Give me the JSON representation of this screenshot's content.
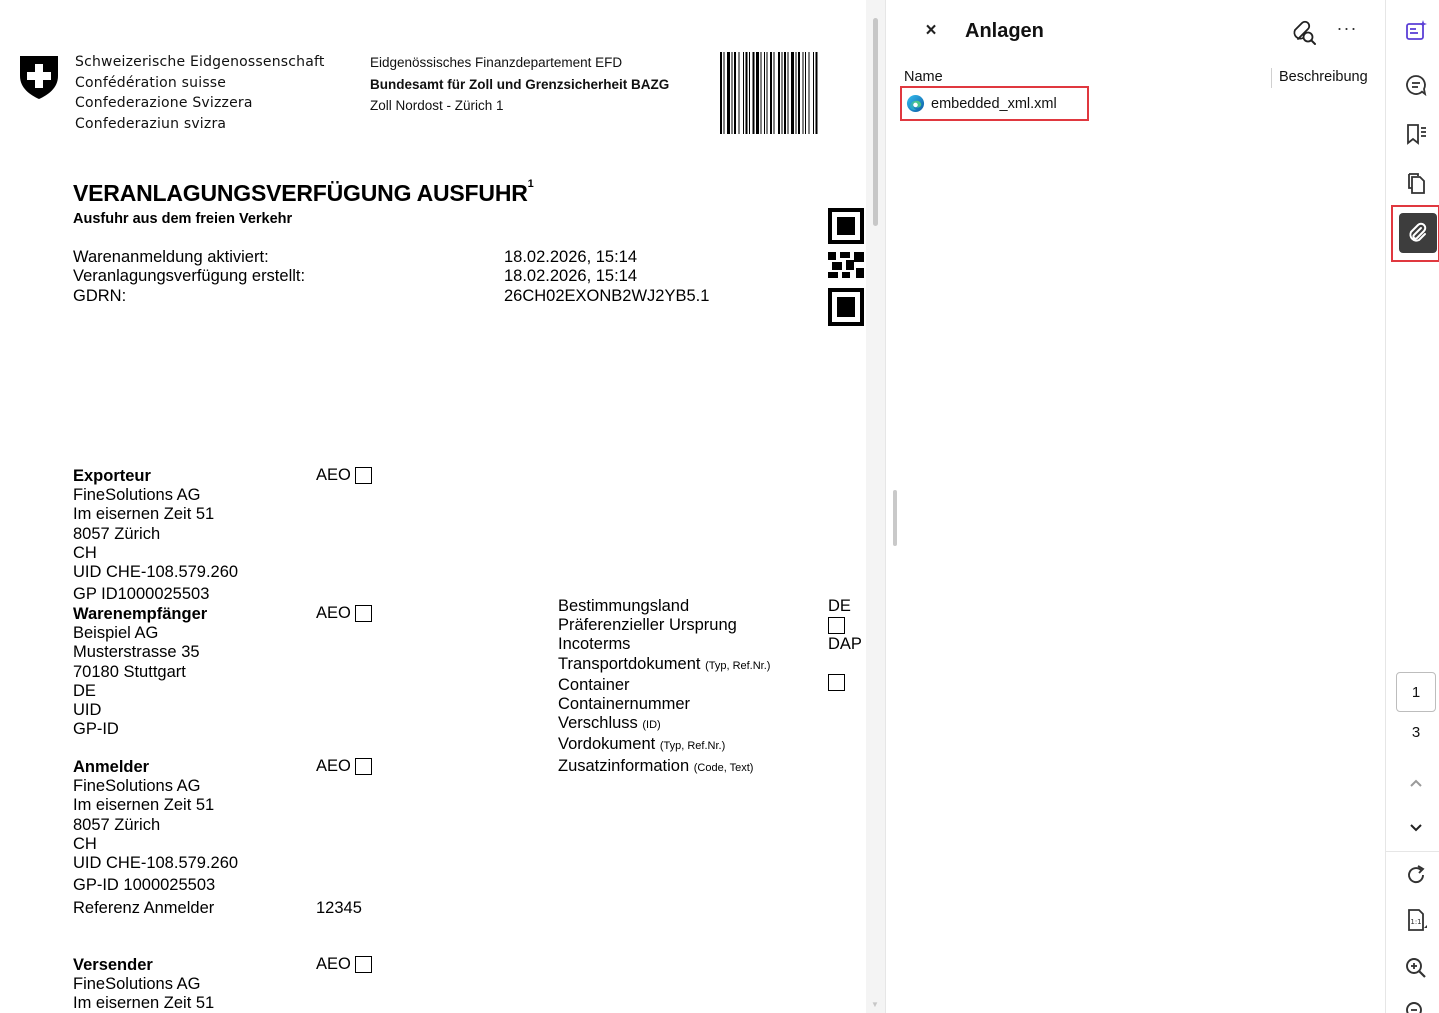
{
  "document": {
    "federation": [
      "Schweizerische Eidgenossenschaft",
      "Confédération suisse",
      "Confederazione Svizzera",
      "Confederaziun svizra"
    ],
    "department": "Eidgenössisches Finanzdepartement EFD",
    "office": "Bundesamt für Zoll und Grenzsicherheit BAZG",
    "branch": "Zoll Nordost - Zürich 1",
    "title": "VERANLAGUNGSVERFÜGUNG AUSFUHR",
    "title_footnote": "1",
    "subtitle": "Ausfuhr aus dem freien Verkehr",
    "meta": [
      {
        "label": "Warenanmeldung aktiviert:",
        "value": "18.02.2026, 15:14"
      },
      {
        "label": "Veranlagungsverfügung erstellt:",
        "value": "18.02.2026, 15:14"
      },
      {
        "label": "GDRN:",
        "value": "26CH02EXONB2WJ2YB5.1"
      }
    ],
    "aeo_label": "AEO",
    "exporteur": {
      "heading": "Exporteur",
      "lines": [
        "FineSolutions AG",
        "Im eisernen Zeit 51",
        "8057 Zürich",
        "CH",
        "UID CHE-108.579.260"
      ],
      "gp": "GP ID1000025503"
    },
    "empfaenger": {
      "heading": "Warenempfänger",
      "lines": [
        "Beispiel AG",
        "Musterstrasse 35",
        "70180 Stuttgart",
        "DE",
        "UID",
        "GP-ID"
      ]
    },
    "anmelder": {
      "heading": "Anmelder",
      "lines": [
        "FineSolutions AG",
        "Im eisernen Zeit 51",
        "8057 Zürich",
        "CH",
        "UID CHE-108.579.260"
      ],
      "gp": "GP-ID 1000025503",
      "ref_label": "Referenz Anmelder",
      "ref_value": "12345"
    },
    "versender": {
      "heading": "Versender",
      "lines": [
        "FineSolutions AG",
        "Im eisernen Zeit 51"
      ]
    },
    "shipment": {
      "bestimmungsland": "Bestimmungsland",
      "bestimmungsland_value": "DE",
      "ursprung": "Präferenzieller Ursprung",
      "incoterms": "Incoterms",
      "incoterms_value": "DAP",
      "transportdokument": "Transportdokument",
      "transportdokument_hint": "(Typ, Ref.Nr.)",
      "container": "Container",
      "containernummer": "Containernummer",
      "verschluss": "Verschluss",
      "verschluss_hint": "(ID)",
      "vordokument": "Vordokument",
      "vordokument_hint": "(Typ, Ref.Nr.)",
      "zusatzinformation": "Zusatzinformation",
      "zusatzinformation_hint": "(Code, Text)"
    }
  },
  "panel": {
    "close": "×",
    "title": "Anlagen",
    "more": "···",
    "columns": {
      "name": "Name",
      "description": "Beschreibung"
    },
    "attachments": [
      {
        "name": "embedded_xml.xml",
        "icon": "edge-icon"
      }
    ]
  },
  "toolbar": {
    "current_page": "1",
    "total_pages": "3"
  },
  "colors": {
    "highlight": "#e0383f",
    "accent": "#5b3fd6",
    "active_bg": "#3d3d3d"
  }
}
